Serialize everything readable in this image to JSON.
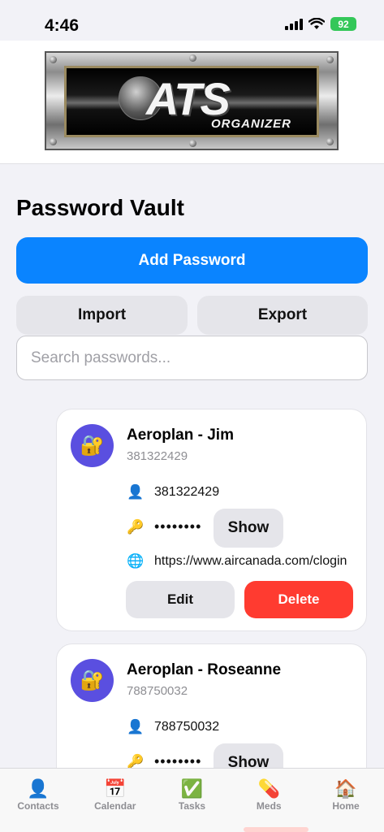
{
  "status_bar": {
    "time": "4:46",
    "battery": "92"
  },
  "header": {
    "logo_text_main": "ATS",
    "logo_text_sub": "ORGANIZER"
  },
  "page": {
    "title": "Password Vault",
    "add_button": "Add Password",
    "import_button": "Import",
    "export_button": "Export",
    "search_placeholder": "Search passwords..."
  },
  "entries": [
    {
      "title": "Aeroplan - Jim",
      "subtitle": "381322429",
      "username": "381322429",
      "masked_password": "••••••••",
      "show_label": "Show",
      "url": "https://www.aircanada.com/clogin",
      "edit_label": "Edit",
      "delete_label": "Delete"
    },
    {
      "title": "Aeroplan - Roseanne",
      "subtitle": "788750032",
      "username": "788750032",
      "masked_password": "••••••••",
      "show_label": "Show"
    }
  ],
  "icons": {
    "entry_avatar": "lock-with-key-icon",
    "username": "user-icon",
    "password": "key-icon",
    "url": "globe-icon"
  },
  "tabbar": [
    {
      "label": "Contacts",
      "icon": "contacts-icon"
    },
    {
      "label": "Calendar",
      "icon": "calendar-icon"
    },
    {
      "label": "Tasks",
      "icon": "checkbox-icon"
    },
    {
      "label": "Meds",
      "icon": "pill-icon"
    },
    {
      "label": "Home",
      "icon": "house-icon"
    }
  ],
  "colors": {
    "primary": "#0a84ff",
    "danger": "#ff3b30",
    "avatar_bg": "#5a4fe0",
    "battery": "#34c759"
  }
}
